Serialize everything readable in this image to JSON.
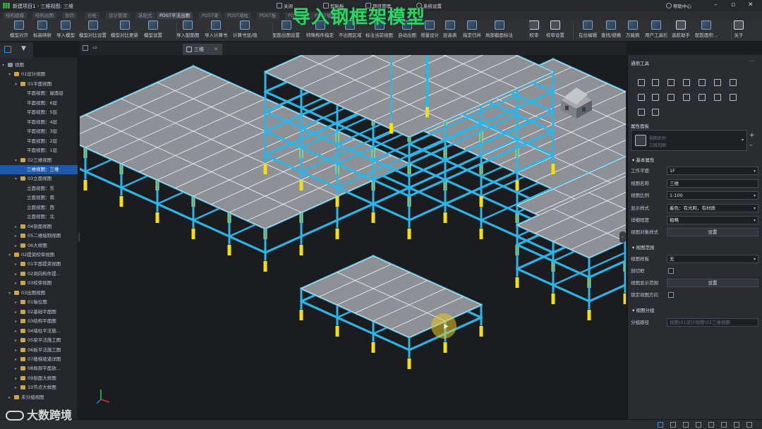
{
  "titlebar": {
    "title": "新建项目1 - 三维视图: 三维",
    "quick": [
      "关闭",
      "剪贴板",
      "项目管理",
      "系统设置"
    ],
    "help": "帮助中心"
  },
  "ribbon_tabs": [
    "结构建模",
    "结构出图",
    "协同",
    "分析",
    "设计管理",
    "装配式",
    "PDST平法出图",
    "PDST梁",
    "PDST墙柱",
    "PDST板",
    "PDST基础",
    "PDST楼梯"
  ],
  "toolbar": [
    "模型对齐",
    "标高映射",
    "导入模型",
    "模型对比设置",
    "模型对比更新",
    "模型设置",
    "导入配筋图",
    "导入计算书",
    "计算书显/隐",
    "配筋出图设置",
    "特殊构件指定",
    "不出图区域",
    "标注当前视图",
    "自动出图",
    "增量设计",
    "层高表",
    "指定归并",
    "局部截面标注",
    "校审",
    "校审设置",
    "在位编辑",
    "查找/替换",
    "万能刷",
    "用户工具栏",
    "选航助手",
    "配筋面积...",
    "关于"
  ],
  "doc_tab": "三维",
  "overlay_title": "导入钢框架模型",
  "watermark": "大数跨境",
  "tree": [
    {
      "label": "视图",
      "indent": 0,
      "tg": "▾",
      "folder": false
    },
    {
      "label": "01设计视图",
      "indent": 1,
      "tg": "▾",
      "folder": true
    },
    {
      "label": "01平面视图",
      "indent": 2,
      "tg": "▾",
      "folder": true
    },
    {
      "label": "平面视图：屋面层",
      "indent": 3
    },
    {
      "label": "平面视图：6层",
      "indent": 3
    },
    {
      "label": "平面视图：5层",
      "indent": 3
    },
    {
      "label": "平面视图：4层",
      "indent": 3
    },
    {
      "label": "平面视图：3层",
      "indent": 3
    },
    {
      "label": "平面视图：2层",
      "indent": 3
    },
    {
      "label": "平面视图：1层",
      "indent": 3
    },
    {
      "label": "02三维视图",
      "indent": 2,
      "tg": "▾",
      "folder": true
    },
    {
      "label": "三维视图：三维",
      "indent": 3,
      "sel": true
    },
    {
      "label": "03立面视图",
      "indent": 2,
      "tg": "▾",
      "folder": true
    },
    {
      "label": "立面视图：东",
      "indent": 3
    },
    {
      "label": "立面视图：南",
      "indent": 3
    },
    {
      "label": "立面视图：西",
      "indent": 3
    },
    {
      "label": "立面视图：北",
      "indent": 3
    },
    {
      "label": "04剖面视图",
      "indent": 2,
      "tg": "▸",
      "folder": true
    },
    {
      "label": "05二维绘制视图",
      "indent": 2,
      "tg": "▸",
      "folder": true
    },
    {
      "label": "06大样图",
      "indent": 2,
      "tg": "▸",
      "folder": true
    },
    {
      "label": "02提资校审视图",
      "indent": 1,
      "tg": "▾",
      "folder": true
    },
    {
      "label": "01平面提资视图",
      "indent": 2,
      "tg": "▸",
      "folder": true
    },
    {
      "label": "02洞向构件提...",
      "indent": 2,
      "tg": "▸",
      "folder": true
    },
    {
      "label": "03校审视图",
      "indent": 2,
      "tg": "▸",
      "folder": true
    },
    {
      "label": "03出图视图",
      "indent": 1,
      "tg": "▾",
      "folder": true
    },
    {
      "label": "01轴位图",
      "indent": 2,
      "tg": "▸",
      "folder": true
    },
    {
      "label": "02基础平面图",
      "indent": 2,
      "tg": "▸",
      "folder": true
    },
    {
      "label": "03结构平面图",
      "indent": 2,
      "tg": "▸",
      "folder": true
    },
    {
      "label": "04墙柱平法施...",
      "indent": 2,
      "tg": "▸",
      "folder": true
    },
    {
      "label": "05梁平法施工图",
      "indent": 2,
      "tg": "▸",
      "folder": true
    },
    {
      "label": "06板平法施工图",
      "indent": 2,
      "tg": "▸",
      "folder": true
    },
    {
      "label": "07楼梯坡道详图",
      "indent": 2,
      "tg": "▸",
      "folder": true
    },
    {
      "label": "08局部平面放...",
      "indent": 2,
      "tg": "▸",
      "folder": true
    },
    {
      "label": "09剖面大样图",
      "indent": 2,
      "tg": "▸",
      "folder": true
    },
    {
      "label": "10节点大样图",
      "indent": 2,
      "tg": "▸",
      "folder": true
    },
    {
      "label": "未分组视图",
      "indent": 1,
      "tg": "▸",
      "folder": true
    }
  ],
  "panel": {
    "tools_title": "通用工具",
    "props_title": "属性面板",
    "view_name_hint": "视图名称",
    "view_type": "三维视图",
    "sec_basic": "基本属性",
    "sec_range": "视图范围",
    "sec_group": "视图分组",
    "props": {
      "work_plane": {
        "label": "工作平面",
        "value": "1F"
      },
      "view_name": {
        "label": "视图名称",
        "value": "三维"
      },
      "scale": {
        "label": "视图比例",
        "value": "1:100"
      },
      "display": {
        "label": "显示样式",
        "value": "着色：有光照，有材质"
      },
      "detail": {
        "label": "详细程度",
        "value": "粗略"
      },
      "obj_style": {
        "label": "视图对象样式",
        "value": "设置"
      },
      "template": {
        "label": "视图样板",
        "value": "无"
      },
      "section_box": {
        "label": "剖切框"
      },
      "display_range": {
        "label": "视图显示范围",
        "value": "设置"
      },
      "lock_dir": {
        "label": "锁定视图方向"
      },
      "group_path": {
        "label": "分组路径",
        "value": "视图\\01设计视图\\02三维视图"
      }
    }
  },
  "colors": {
    "steel": "#2bb6e8",
    "slab": "#8d9094",
    "pile": "#f2dd18",
    "overlay": "#2bd66a"
  }
}
